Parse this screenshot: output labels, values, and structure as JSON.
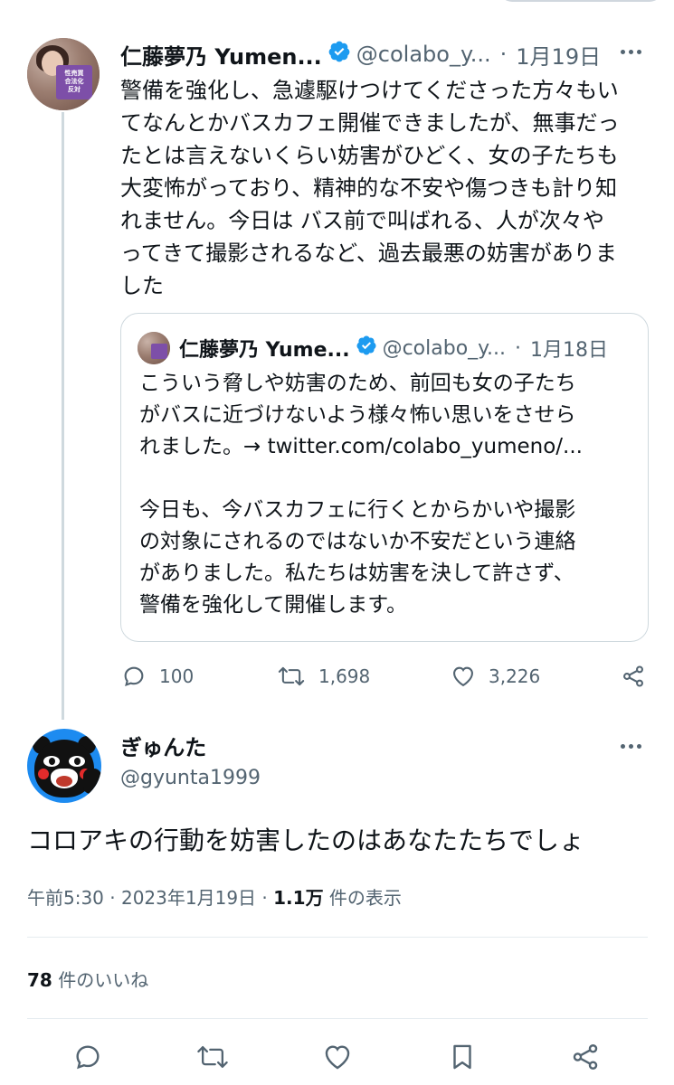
{
  "parent_tweet": {
    "author_name": "仁藤夢乃 Yumen...",
    "handle": "@colabo_y...",
    "separator": "·",
    "date": "1月19日",
    "avatar_sign_text": "性売買\n合法化\n反対",
    "text_lines": [
      "警備を強化し、急遽駆けつけてくださった方々もい",
      "てなんとかバスカフェ開催できましたが、無事だっ",
      "たとは言えないくらい妨害がひどく、女の子たちも",
      "大変怖がっており、精神的な不安や傷つきも計り知",
      "れません。今日は バス前で叫ばれる、人が次々や",
      "ってきて撮影されるなど、過去最悪の妨害がありま",
      "した"
    ],
    "quote": {
      "author_name": "仁藤夢乃 Yume...",
      "handle": "@colabo_y...",
      "separator": "·",
      "date": "1月18日",
      "text_lines": [
        "こういう脅しや妨害のため、前回も女の子たち",
        "がバスに近づけないよう様々怖い思いをさせら",
        "れました。→ twitter.com/colabo_yumeno/...",
        "",
        "今日も、今バスカフェに行くとからかいや撮影",
        "の対象にされるのではないか不安だという連絡",
        "がありました。私たちは妨害を決して許さず、",
        "警備を強化して開催します。"
      ]
    },
    "actions": {
      "replies": "100",
      "retweets": "1,698",
      "likes": "3,226"
    }
  },
  "reply_tweet": {
    "author_name": "ぎゅんた",
    "handle": "@gyunta1999",
    "text": "コロアキの行動を妨害したのはあなたたちでしょ",
    "time": "午前5:30 · 2023年1月19日 · ",
    "views_count": "1.1万",
    "views_label": " 件の表示",
    "likes_count": "78",
    "likes_label": " 件のいいね"
  },
  "icons": {
    "verified": "verified-badge-icon",
    "reply": "reply-icon",
    "retweet": "retweet-icon",
    "like": "heart-icon",
    "share": "share-icon",
    "bookmark": "bookmark-icon",
    "more": "more-icon"
  },
  "colors": {
    "verified_blue": "#1d9bf0",
    "text_primary": "#0f1419",
    "text_secondary": "#536471",
    "border": "#cfd9de"
  }
}
